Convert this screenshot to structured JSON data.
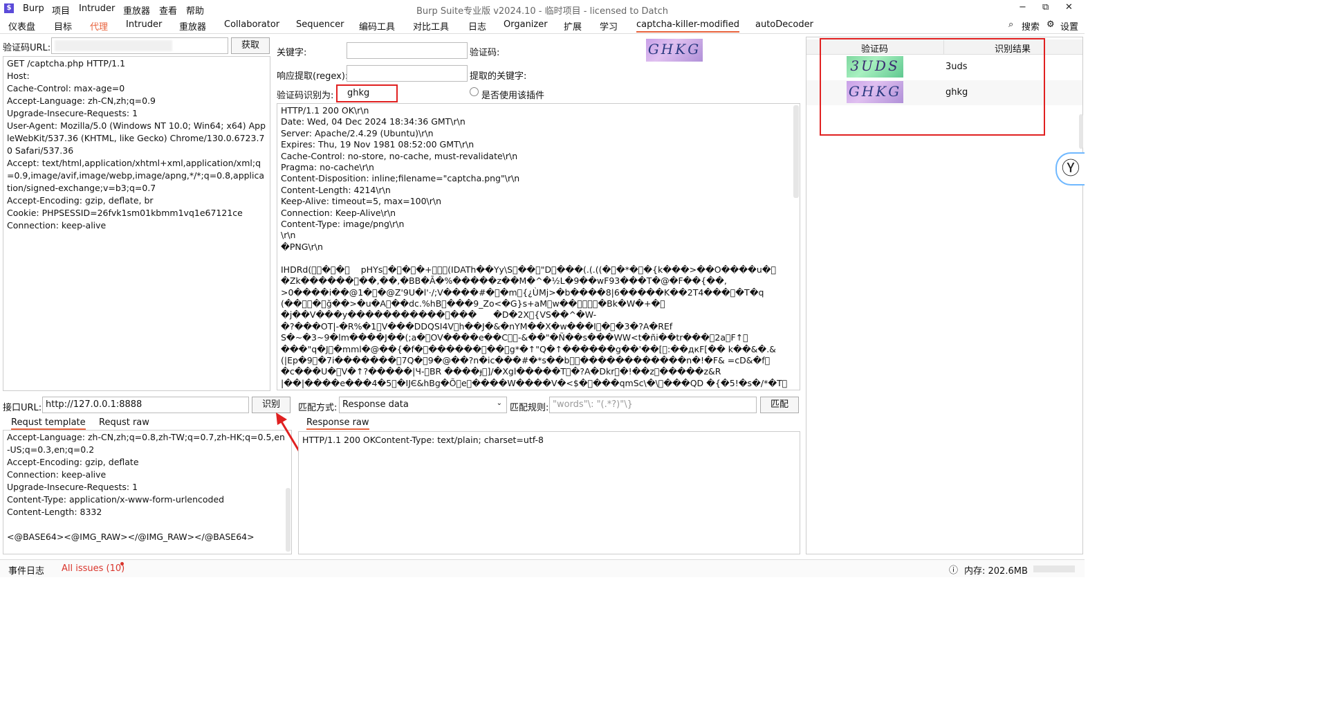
{
  "app": {
    "logo": "$",
    "title": "Burp Suite专业版  v2024.10 - 临时项目 - licensed to Datch",
    "menu": [
      "Burp",
      "项目",
      "Intruder",
      "重放器",
      "查看",
      "帮助"
    ],
    "window_controls": [
      "−",
      "⧉",
      "✕"
    ]
  },
  "tabs": [
    "仪表盘",
    "目标",
    "代理",
    "Intruder",
    "重放器",
    "Collaborator",
    "Sequencer",
    "编码工具",
    "对比工具",
    "日志",
    "Organizer",
    "扩展",
    "学习",
    "captcha-killer-modified",
    "autoDecoder"
  ],
  "tabs_right": {
    "search": "搜索",
    "settings": "设置"
  },
  "left_top": {
    "url_label": "验证码URL:",
    "url_value": "",
    "fetch_button": "获取",
    "request_lines": "GET /captcha.php HTTP/1.1\nHost: \nCache-Control: max-age=0\nAccept-Language: zh-CN,zh;q=0.9\nUpgrade-Insecure-Requests: 1\nUser-Agent: Mozilla/5.0 (Windows NT 10.0; Win64; x64) AppleWebKit/537.36 (KHTML, like Gecko) Chrome/130.0.6723.70 Safari/537.36\nAccept: text/html,application/xhtml+xml,application/xml;q=0.9,image/avif,image/webp,image/apng,*/*;q=0.8,application/signed-exchange;v=b3;q=0.7\nAccept-Encoding: gzip, deflate, br\nCookie: PHPSESSID=26fvk1sm01kbmm1vq1e67121ce\nConnection: keep-alive"
  },
  "middle_top": {
    "keyword_label": "关键字:",
    "captcha_label": "验证码:",
    "regex_label": "响应提取(regex):",
    "extracted_label": "提取的关键字:",
    "recognized_label": "验证码识别为:",
    "recognized_value": "ghkg",
    "use_plugin_label": "是否使用该插件",
    "captcha_image_text": "GHKG",
    "response_text": "HTTP/1.1 200 OK\\r\\n\nDate: Wed, 04 Dec 2024 18:34:36 GMT\\r\\n\nServer: Apache/2.4.29 (Ubuntu)\\r\\n\nExpires: Thu, 19 Nov 1981 08:52:00 GMT\\r\\n\nCache-Control: no-store, no-cache, must-revalidate\\r\\n\nPragma: no-cache\\r\\n\nContent-Disposition: inline;filename=\"captcha.png\"\\r\\n\nContent-Length: 4214\\r\\n\nKeep-Alive: timeout=5, max=100\\r\\n\nConnection: Keep-Alive\\r\\n\nContent-Type: image/png\\r\\n\n\\r\\n\n�PNG\\r\\n\n\nIHDRd(\u0000\u0000�\u0000�\u0000    pHYs\u0000�\u0000�\u0000�+\u0000\u0000\u0000(IDATh��Yy\\S\u0000��\u0000\"D\u0000���(.(.((�\u0000�*�\u0000�{k���>��O����u�\u0000\n�Zk������\u0000��,��,�BB�Ā�%�����z��M�^�½L�9��wF93���T�@�F��{��,\n>0����i��@1�\u0000�@Z'9U�l'·/;V����#�\u0000�m\u0000{¿ÙMj>�b����8|6�����K��2T4���\u0000�T�q\n(��\u0000\u0000�\u0000ğ��>�u�A\u0000��dc.%hB\u0000���9_Zo<�G}s+aM\u0000w��\u0000\u0000\u0000\u0000�Bk�W�+�\u0000\n�j��V���y�����������\u0000���      �D�2X\u0000{VS��^�W-\n�?���OT|-�R%�1\u0000V���DDQSI4V\u0000h��J�&�nYM��X�w���I\u0000�\u0000�3�?A�REf\nS�~�3~9�lm����J��(;a�\u0000OV����e��C\u0000\u0000-&��\"�Ñ��s���WW<t�ñi��tr���\u00002a\u0000F↑\u0000\n���\"q�J\u0000�mml�@��{�f�\u0000������\u0000��\u0000g*�↑\"Q�↑������g��'��[\u0000:��дкF[�� k��&�.&\n(|Ep�9\u0000�7i�������\u00007Q�\u00009�@��?n�ic���#�*s��b\u0000\u0000������������n�!�F& =cD&�f\u0000\n�c���U�\u0000V�↑?�����|Ч-\u0000BR ����ɟ\u0000]/�Xgl�����T\u0000�?A�Dkr\u0000�!��z\u0000�����z&R\n|��|����e���4�5\u0000�IJЄ&hBg�Õ\u0000e\u0000����W����V�<$�\u0000���qmSc\\�\\\u0000���QD �{�5!�s�/*�T\u0000"
  },
  "right_top": {
    "col_captcha": "验证码",
    "col_result": "识别结果",
    "rows": [
      {
        "image_text": "3UDS",
        "result": "3uds"
      },
      {
        "image_text": "GHKG",
        "result": "ghkg"
      }
    ]
  },
  "left_bottom": {
    "api_label": "接口URL:",
    "api_value": "http://127.0.0.1:8888",
    "recognize_button": "识别",
    "tab_template": "Requst template",
    "tab_raw": "Requst raw",
    "template_text": "Accept-Language: zh-CN,zh;q=0.8,zh-TW;q=0.7,zh-HK;q=0.5,en-US;q=0.3,en;q=0.2\nAccept-Encoding: gzip, deflate\nConnection: keep-alive\nUpgrade-Insecure-Requests: 1\nContent-Type: application/x-www-form-urlencoded\nContent-Length: 8332\n\n<@BASE64><@IMG_RAW></@IMG_RAW></@BASE64>"
  },
  "middle_bottom": {
    "match_mode_label": "匹配方式:",
    "match_mode_value": "Response data",
    "match_rule_label": "匹配规则:",
    "match_rule_placeholder": "\"words\"\\: \"(.*?)\"\\}",
    "match_button": "匹配",
    "tab_response_raw": "Response raw",
    "response_text": "HTTP/1.1 200 OKContent-Type: text/plain; charset=utf-8"
  },
  "status": {
    "event_log": "事件日志",
    "all_issues": "All issues (10)",
    "memory": "内存: 202.6MB"
  },
  "colors": {
    "accent": "#e8623c",
    "red_highlight": "#e02020"
  }
}
